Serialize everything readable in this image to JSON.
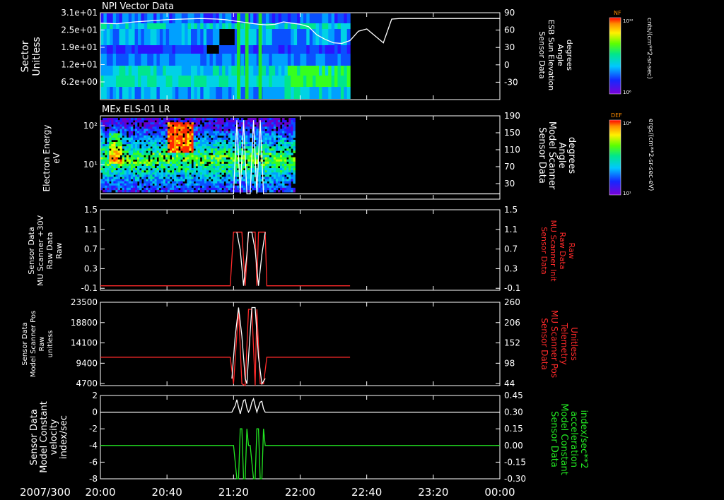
{
  "date_label": "2007/300",
  "time_axis": {
    "labels": [
      "20:00",
      "20:40",
      "21:20",
      "22:00",
      "22:40",
      "23:20",
      "00:00"
    ],
    "minutes": [
      0,
      40,
      80,
      120,
      160,
      200,
      240
    ]
  },
  "colors": {
    "background": "#000000",
    "axis": "#ffffff",
    "red_series": "#ff2a2a",
    "green_series": "#22e622",
    "white_series": "#ffffff"
  },
  "chart_data": [
    {
      "id": "p1",
      "type": "heatmap",
      "title": "NPI Vector Data",
      "ylabel_lines": [
        "Sector",
        "Unitless"
      ],
      "yticks": [
        "3.1e+01",
        "2.5e+01",
        "1.9e+01",
        "1.2e+01",
        "6.2e+00"
      ],
      "y2label_lines": [
        "Sensor Data",
        "ESB Sun Elevation",
        "Angle",
        "degrees"
      ],
      "y2ticks": [
        "90",
        "60",
        "30",
        "0",
        "-30"
      ],
      "y2lim": [
        -60,
        90
      ],
      "data_range_minutes": [
        0,
        150
      ],
      "overlay_line": {
        "color": "white",
        "x": [
          0,
          10,
          20,
          30,
          40,
          50,
          60,
          70,
          75,
          80,
          85,
          90,
          95,
          100,
          105,
          110,
          115,
          120,
          125,
          130,
          135,
          140,
          145,
          150,
          155,
          160,
          165,
          170,
          175,
          180,
          190,
          200,
          240
        ],
        "y": [
          72,
          71,
          74,
          76,
          78,
          79,
          80,
          79,
          78,
          76,
          74,
          72,
          70,
          69,
          70,
          74,
          72,
          70,
          66,
          52,
          44,
          38,
          37,
          42,
          58,
          62,
          50,
          38,
          79,
          80,
          80,
          80,
          80
        ]
      },
      "colorbar": {
        "label": "NF",
        "top_tick": "10¹²",
        "bottom_tick": "10⁶",
        "units": "cnts/(cm**2-sr-sec)"
      }
    },
    {
      "id": "p2",
      "type": "heatmap",
      "title": "MEx ELS-01 LR",
      "ylabel_lines": [
        "Electron Energy",
        "eV"
      ],
      "yticks": [
        "10²",
        "10¹"
      ],
      "y2label_lines": [
        "Sensor Data",
        "Model Scanner",
        "Angle",
        "degrees"
      ],
      "y2ticks": [
        "190",
        "150",
        "110",
        "70",
        "30"
      ],
      "y2lim": [
        0,
        190
      ],
      "data_range_minutes": [
        0,
        117
      ],
      "colorbar": {
        "label": "DEF",
        "top_tick": "10⁴",
        "bottom_tick": "10¹",
        "units": "ergs/(cm**2-sr-sec-eV)"
      }
    },
    {
      "id": "p3",
      "type": "line",
      "ylabel_lines": [
        "Sensor Data",
        "MU Scanner +30V",
        "Raw Data",
        "Raw"
      ],
      "yticks": [
        "1.5",
        "1.1",
        "0.7",
        "0.3",
        "-0.1"
      ],
      "ylim": [
        -0.3,
        1.5
      ],
      "y2label_lines": [
        "Sensor Data",
        "MU Scanner Init",
        "Raw Data",
        "Raw"
      ],
      "y2ticks": [
        "1.5",
        "1.1",
        "0.7",
        "0.3",
        "-0.1"
      ],
      "series": [
        {
          "color": "red",
          "x": [
            0,
            78,
            80,
            85,
            87,
            89,
            91,
            93,
            94,
            95,
            96,
            99,
            100,
            150
          ],
          "y": [
            -0.2,
            -0.2,
            1.0,
            1.0,
            -0.2,
            1.0,
            1.0,
            1.0,
            -0.2,
            1.0,
            1.0,
            1.0,
            -0.2,
            -0.2
          ]
        },
        {
          "color": "white",
          "x": [
            82,
            84,
            86,
            88,
            89,
            91,
            93,
            95,
            97,
            99
          ],
          "y": [
            1.0,
            0.6,
            -0.2,
            0.5,
            1.0,
            1.0,
            0.6,
            -0.2,
            0.5,
            1.0
          ]
        }
      ]
    },
    {
      "id": "p4",
      "type": "line",
      "ylabel_lines": [
        "Sensor Data",
        "Model Scanner Pos",
        "Raw",
        "unitless"
      ],
      "yticks": [
        "23500",
        "18800",
        "14100",
        "9400",
        "4700"
      ],
      "ylim": [
        0,
        23500
      ],
      "y2label_lines": [
        "Sensor Data",
        "MU Scanner Pos",
        "Telemetry",
        "Unitless"
      ],
      "y2ticks": [
        "260",
        "206",
        "152",
        "98",
        "44"
      ],
      "series": [
        {
          "color": "red",
          "x": [
            0,
            78,
            80,
            83,
            85,
            87,
            89,
            91,
            93,
            94,
            96,
            98,
            100,
            150
          ],
          "y": [
            8000,
            8000,
            500,
            21500,
            500,
            0,
            21500,
            21500,
            0,
            21500,
            500,
            500,
            8000,
            8000
          ]
        },
        {
          "color": "white",
          "x": [
            79,
            81,
            83,
            85,
            87,
            88,
            89,
            91,
            93,
            95,
            97,
            99
          ],
          "y": [
            2000,
            14000,
            22000,
            14000,
            2000,
            500,
            8000,
            22000,
            22000,
            8000,
            500,
            2000
          ]
        }
      ]
    },
    {
      "id": "p5",
      "type": "line",
      "ylabel_lines": [
        "Sensor Data",
        "Model Constant",
        "velocity",
        "index/sec"
      ],
      "yticks": [
        "2",
        "0",
        "-2",
        "-4",
        "-6",
        "-8"
      ],
      "ylim": [
        -8,
        2
      ],
      "y2label_lines": [
        "Sensor Data",
        "Model Constant",
        "acceleration",
        "index/sec**2"
      ],
      "y2ticks": [
        "0.45",
        "0.30",
        "0.15",
        "0.00",
        "-0.15",
        "-0.30"
      ],
      "series": [
        {
          "color": "white",
          "x": [
            0,
            78,
            79,
            81,
            82,
            83,
            84,
            85,
            86,
            87,
            88,
            89,
            90,
            91,
            92,
            93,
            94,
            95,
            96,
            97,
            98,
            99,
            240
          ],
          "y": [
            0,
            0,
            0,
            0.8,
            1.5,
            0.6,
            -0.2,
            0.6,
            1.4,
            1.5,
            0.5,
            0,
            0.4,
            1.2,
            1.6,
            0.8,
            0,
            0.6,
            1.2,
            1.3,
            0.4,
            0,
            0
          ]
        },
        {
          "color": "green",
          "x": [
            0,
            80,
            81,
            82,
            83,
            84,
            85,
            86,
            87,
            88,
            89,
            90,
            91,
            92,
            93,
            94,
            95,
            96,
            97,
            98,
            99,
            100,
            101,
            240
          ],
          "y": [
            -4,
            -4,
            -6,
            -8,
            -8,
            -2,
            -2,
            -8,
            -8,
            -2,
            -4,
            -4,
            -6,
            -8,
            -8,
            -2,
            -2,
            -8,
            -8,
            -2,
            -4,
            -4,
            -4,
            -4
          ]
        }
      ]
    }
  ]
}
